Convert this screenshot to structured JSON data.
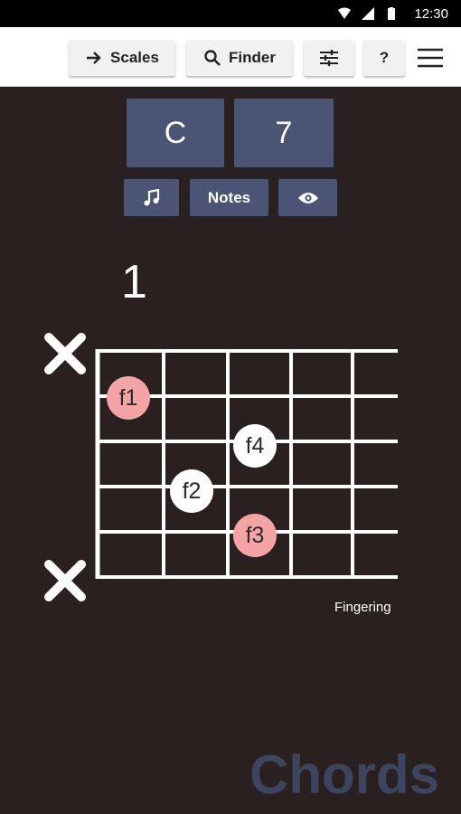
{
  "status_bar": {
    "time": "12:30",
    "icons": [
      "wifi-icon",
      "signal-icon",
      "battery-icon"
    ]
  },
  "toolbar": {
    "scales_label": "Scales",
    "finder_label": "Finder",
    "help_label": "?"
  },
  "chord": {
    "root": "C",
    "type": "7",
    "notes_label": "Notes"
  },
  "fretboard": {
    "fret_number": "1",
    "mode_label": "Fingering",
    "fingers": [
      {
        "label": "f1",
        "string": 2,
        "fret": 1,
        "color": "#f4a4a4"
      },
      {
        "label": "f4",
        "string": 3,
        "fret": 3,
        "color": "#ffffff"
      },
      {
        "label": "f2",
        "string": 4,
        "fret": 2,
        "color": "#ffffff"
      },
      {
        "label": "f3",
        "string": 5,
        "fret": 3,
        "color": "#f4a4a4"
      }
    ],
    "muted_strings": [
      1,
      6
    ]
  },
  "watermark": "Chords",
  "colors": {
    "background": "#2b2020",
    "accent": "#4a5474",
    "highlight_finger": "#f4a4a4",
    "watermark": "#3c4560"
  }
}
